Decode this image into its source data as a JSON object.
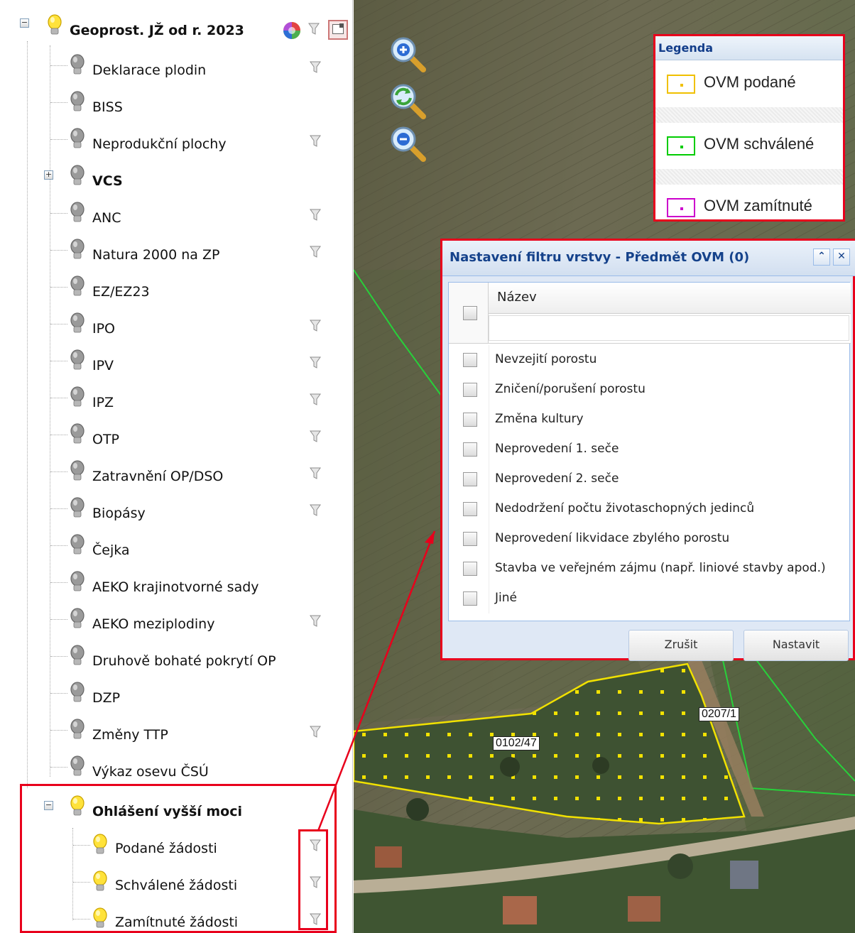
{
  "layer_tree": {
    "root": {
      "label": "Geoprost. JŽ od r. 2023",
      "expander": "−"
    },
    "items": [
      {
        "label": "Deklarace plodin",
        "filter": true
      },
      {
        "label": "BISS",
        "filter": false
      },
      {
        "label": "Neprodukční plochy",
        "filter": true
      },
      {
        "label": "VCS",
        "filter": false,
        "bold": true,
        "expander": "+"
      },
      {
        "label": "ANC",
        "filter": true
      },
      {
        "label": "Natura 2000 na ZP",
        "filter": true
      },
      {
        "label": "EZ/EZ23",
        "filter": false
      },
      {
        "label": "IPO",
        "filter": true
      },
      {
        "label": "IPV",
        "filter": true
      },
      {
        "label": "IPZ",
        "filter": true
      },
      {
        "label": "OTP",
        "filter": true
      },
      {
        "label": "Zatravnění OP/DSO",
        "filter": true
      },
      {
        "label": "Biopásy",
        "filter": true
      },
      {
        "label": "Čejka",
        "filter": false
      },
      {
        "label": "AEKO krajinotvorné sady",
        "filter": false
      },
      {
        "label": "AEKO meziplodiny",
        "filter": true
      },
      {
        "label": "Druhově bohaté pokrytí OP",
        "filter": false
      },
      {
        "label": "DZP",
        "filter": false
      },
      {
        "label": "Změny TTP",
        "filter": true
      },
      {
        "label": "Výkaz osevu ČSÚ",
        "filter": false
      }
    ],
    "group": {
      "label": "Ohlášení vyšší moci",
      "expander": "−",
      "children": [
        {
          "label": "Podané žádosti",
          "filter": true
        },
        {
          "label": "Schválené žádosti",
          "filter": true
        },
        {
          "label": "Zamítnuté žádosti",
          "filter": true
        }
      ]
    }
  },
  "map": {
    "parcel_labels": [
      "0102/47",
      "0207/1"
    ],
    "zoom_in_icon": "zoom-in-icon",
    "zoom_reset_icon": "zoom-reset-icon",
    "zoom_out_icon": "zoom-out-icon"
  },
  "legend": {
    "title": "Legenda",
    "items": [
      {
        "label": "OVM podané",
        "color": "#f0c000"
      },
      {
        "label": "OVM schválené",
        "color": "#00cc00"
      },
      {
        "label": "OVM zamítnuté",
        "color": "#cc00cc"
      }
    ]
  },
  "filter_dialog": {
    "title": "Nastavení filtru vrstvy - Předmět OVM (0)",
    "column_header": "Název",
    "filter_value": "",
    "rows": [
      "Nevzejití porostu",
      "Zničení/porušení porostu",
      "Změna kultury",
      "Neprovedení 1. seče",
      "Neprovedení 2. seče",
      "Nedodržení počtu životaschopných jedinců",
      "Neprovedení likvidace zbylého porostu",
      "Stavba ve veřejném zájmu (např. liniové stavby apod.)",
      "Jiné"
    ],
    "cancel_label": "Zrušit",
    "ok_label": "Nastavit"
  },
  "colors": {
    "highlight": "#e8001c",
    "dialog_title": "#15428b",
    "bulb_on": "#ffd700",
    "bulb_off": "#8a8a8a"
  }
}
